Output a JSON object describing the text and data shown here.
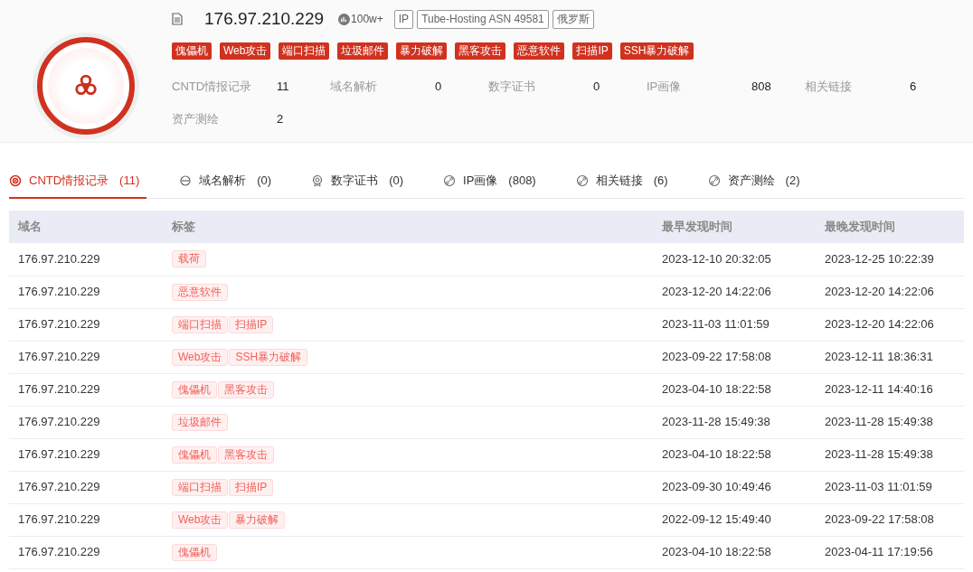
{
  "header": {
    "ip": "176.97.210.229",
    "heat": "100w+",
    "meta_tags": [
      "IP",
      "Tube-Hosting ASN 49581",
      "俄罗斯"
    ],
    "threat_tags": [
      "傀儡机",
      "Web攻击",
      "端口扫描",
      "垃圾邮件",
      "暴力破解",
      "黑客攻击",
      "恶意软件",
      "扫描IP",
      "SSH暴力破解"
    ],
    "stats": [
      {
        "label": "CNTD情报记录",
        "value": "11"
      },
      {
        "label": "域名解析",
        "value": "0"
      },
      {
        "label": "数字证书",
        "value": "0"
      },
      {
        "label": "IP画像",
        "value": "808"
      },
      {
        "label": "相关链接",
        "value": "6"
      },
      {
        "label": "资产测绘",
        "value": "2"
      }
    ]
  },
  "tabs": [
    {
      "kind": "radar",
      "label": "CNTD情报记录",
      "count": "(11)",
      "selected": true
    },
    {
      "kind": "dns",
      "label": "域名解析",
      "count": "(0)",
      "selected": false
    },
    {
      "kind": "cert",
      "label": "数字证书",
      "count": "(0)",
      "selected": false
    },
    {
      "kind": "link",
      "label": "IP画像",
      "count": "(808)",
      "selected": false
    },
    {
      "kind": "link",
      "label": "相关链接",
      "count": "(6)",
      "selected": false
    },
    {
      "kind": "link",
      "label": "资产测绘",
      "count": "(2)",
      "selected": false
    }
  ],
  "table": {
    "columns": [
      "域名",
      "标签",
      "最早发现时间",
      "最晚发现时间"
    ],
    "rows": [
      {
        "domain": "176.97.210.229",
        "tags": [
          "载荷"
        ],
        "first_seen": "2023-12-10 20:32:05",
        "last_seen": "2023-12-25 10:22:39"
      },
      {
        "domain": "176.97.210.229",
        "tags": [
          "恶意软件"
        ],
        "first_seen": "2023-12-20 14:22:06",
        "last_seen": "2023-12-20 14:22:06"
      },
      {
        "domain": "176.97.210.229",
        "tags": [
          "端口扫描",
          "扫描IP"
        ],
        "first_seen": "2023-11-03 11:01:59",
        "last_seen": "2023-12-20 14:22:06"
      },
      {
        "domain": "176.97.210.229",
        "tags": [
          "Web攻击",
          "SSH暴力破解"
        ],
        "first_seen": "2023-09-22 17:58:08",
        "last_seen": "2023-12-11 18:36:31"
      },
      {
        "domain": "176.97.210.229",
        "tags": [
          "傀儡机",
          "黑客攻击"
        ],
        "first_seen": "2023-04-10 18:22:58",
        "last_seen": "2023-12-11 14:40:16"
      },
      {
        "domain": "176.97.210.229",
        "tags": [
          "垃圾邮件"
        ],
        "first_seen": "2023-11-28 15:49:38",
        "last_seen": "2023-11-28 15:49:38"
      },
      {
        "domain": "176.97.210.229",
        "tags": [
          "傀儡机",
          "黑客攻击"
        ],
        "first_seen": "2023-04-10 18:22:58",
        "last_seen": "2023-11-28 15:49:38"
      },
      {
        "domain": "176.97.210.229",
        "tags": [
          "端口扫描",
          "扫描IP"
        ],
        "first_seen": "2023-09-30 10:49:46",
        "last_seen": "2023-11-03 11:01:59"
      },
      {
        "domain": "176.97.210.229",
        "tags": [
          "Web攻击",
          "暴力破解"
        ],
        "first_seen": "2022-09-12 15:49:40",
        "last_seen": "2023-09-22 17:58:08"
      },
      {
        "domain": "176.97.210.229",
        "tags": [
          "傀儡机"
        ],
        "first_seen": "2023-04-10 18:22:58",
        "last_seen": "2023-04-11 17:19:56"
      }
    ]
  }
}
